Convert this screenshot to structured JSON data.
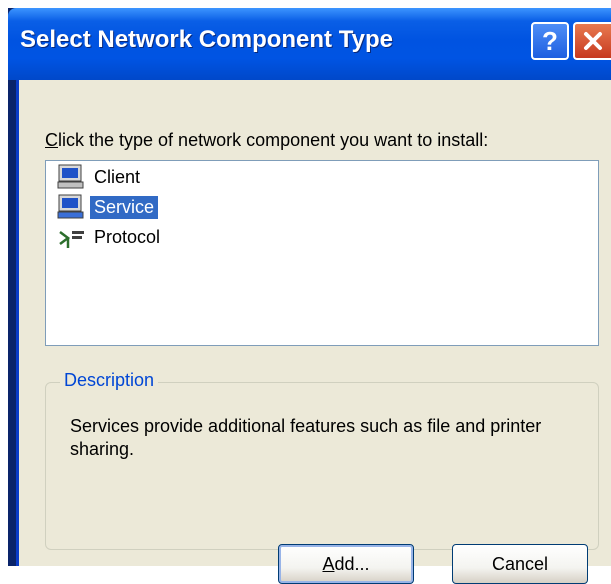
{
  "window": {
    "title": "Select Network Component Type",
    "help_button": "?",
    "close_button": "close-icon"
  },
  "prompt": {
    "accel": "C",
    "rest": "lick the type of network component you want to install:"
  },
  "components": [
    {
      "label": "Client",
      "icon": "client-monitor-icon",
      "selected": false
    },
    {
      "label": "Service",
      "icon": "service-monitor-icon",
      "selected": true
    },
    {
      "label": "Protocol",
      "icon": "protocol-network-icon",
      "selected": false
    }
  ],
  "description": {
    "legend": "Description",
    "text": "Services provide additional features such as file and printer sharing."
  },
  "buttons": {
    "add_accel": "A",
    "add_rest": "dd...",
    "cancel": "Cancel"
  },
  "colors": {
    "title_bar": "#0054e3",
    "selection": "#316ac5",
    "legend_text": "#0046d5",
    "dialog_bg": "#ece9d8"
  }
}
